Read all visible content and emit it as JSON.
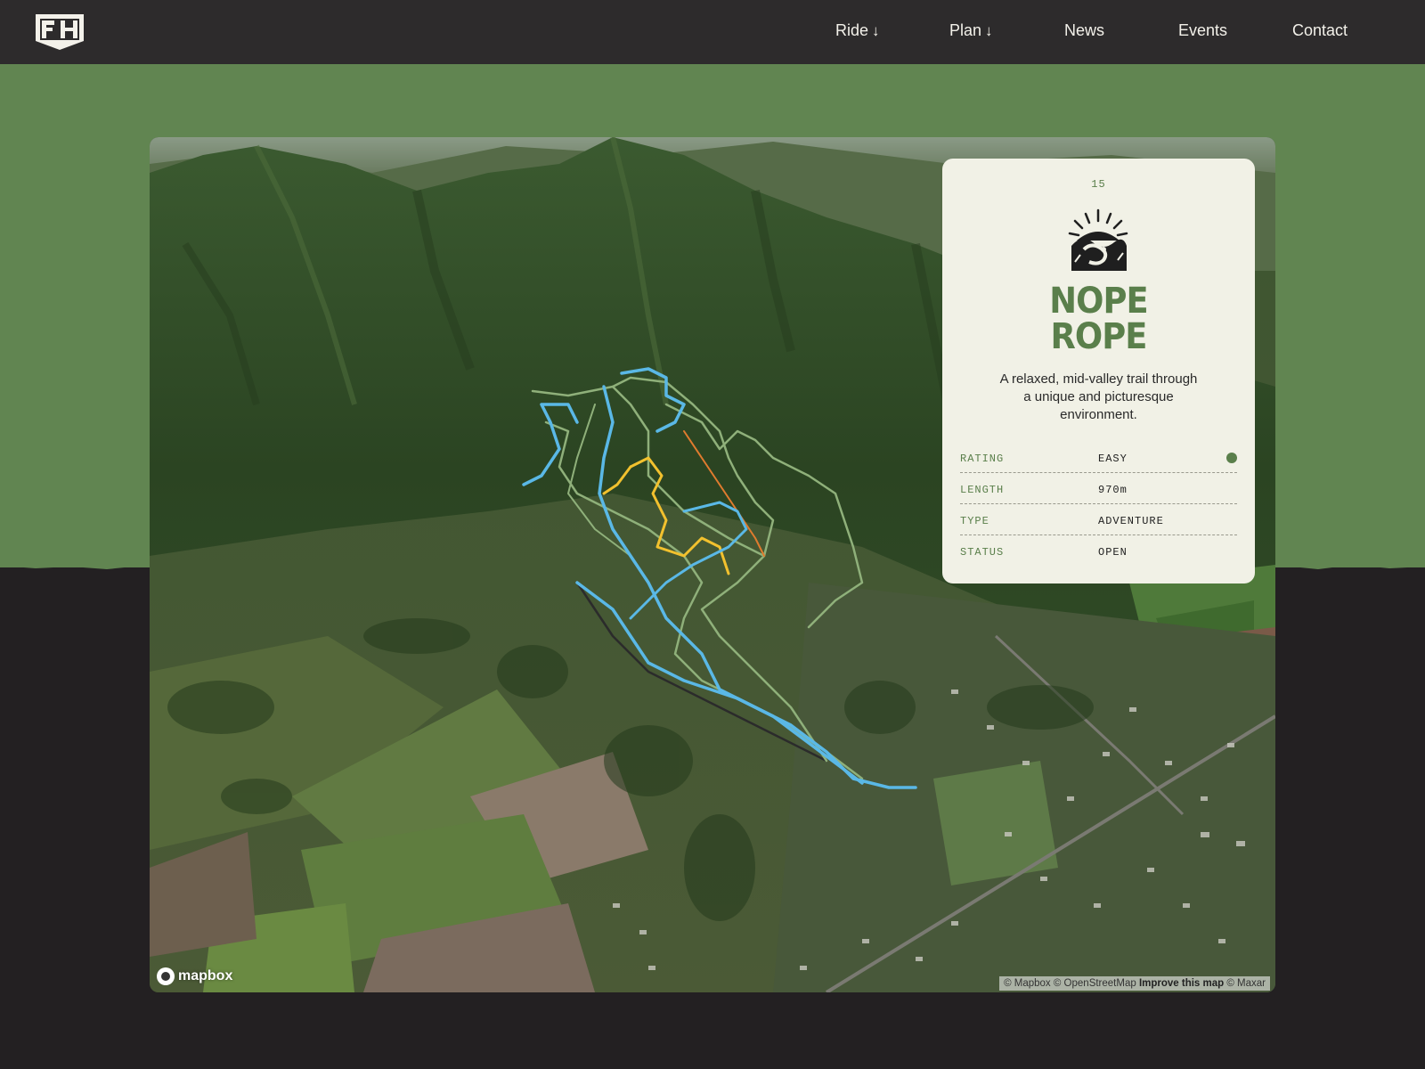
{
  "nav": {
    "logo_text": "FH",
    "items": [
      {
        "label": "Ride",
        "arrow": "↓"
      },
      {
        "label": "Plan",
        "arrow": "↓"
      },
      {
        "label": "News",
        "arrow": ""
      },
      {
        "label": "Events",
        "arrow": ""
      },
      {
        "label": "Contact",
        "arrow": ""
      }
    ]
  },
  "map": {
    "provider_logo": "mapbox",
    "attribution": {
      "mapbox": "© Mapbox",
      "osm": "© OpenStreetMap",
      "improve": "Improve this map",
      "maxar": "© Maxar"
    },
    "trail_colors": {
      "blue": "#5ab8e6",
      "green": "#8fb07a",
      "yellow": "#f2c12e",
      "orange": "#e07b2e",
      "dark": "#2b2b2b"
    }
  },
  "trail_card": {
    "number": "15",
    "title": "NOPE\nROPE",
    "description": "A relaxed, mid-valley trail through a unique and picturesque environment.",
    "badge_icon": "snake-sun-icon",
    "specs": [
      {
        "label": "RATING",
        "value": "EASY",
        "indicator": "#5a7f4b"
      },
      {
        "label": "LENGTH",
        "value": "970m"
      },
      {
        "label": "TYPE",
        "value": "ADVENTURE"
      },
      {
        "label": "STATUS",
        "value": "OPEN"
      }
    ]
  },
  "colors": {
    "topbar": "#2d2b2c",
    "green_band": "#618551",
    "page_bottom": "#232022",
    "card_bg": "#f1f1e6",
    "brand_green": "#5a7f4b"
  }
}
